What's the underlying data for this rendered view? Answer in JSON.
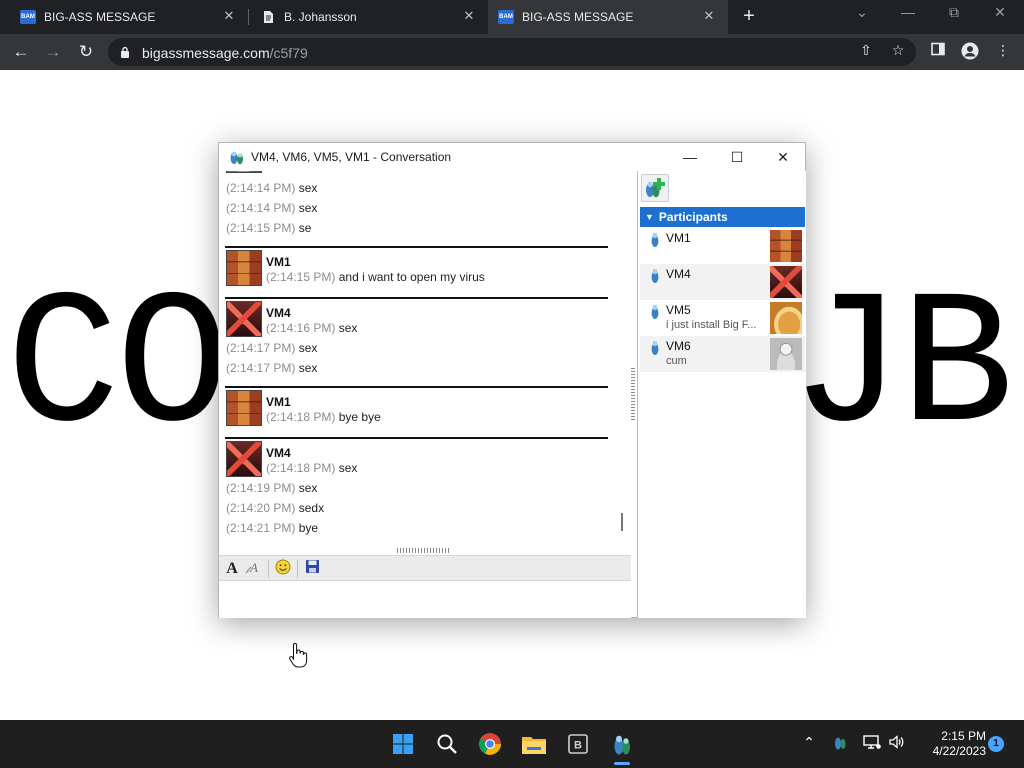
{
  "browser": {
    "tabs": [
      {
        "title": "BIG-ASS MESSAGE",
        "favicon": "bam-icon",
        "active": false
      },
      {
        "title": "B. Johansson",
        "favicon": "doc-icon",
        "active": false
      },
      {
        "title": "BIG-ASS MESSAGE",
        "favicon": "bam-icon",
        "active": true
      }
    ],
    "favicon_text": "BAM",
    "url_host": "bigassmessage.com",
    "url_path": "/c5f79",
    "icons": {
      "back": "←",
      "forward": "→",
      "reload": "↻",
      "share": "⇧",
      "star": "☆",
      "menu": "⋮",
      "new_tab": "+",
      "tab_close": "✕",
      "win_min": "—",
      "win_restore": "⧉",
      "win_close": "✕",
      "tab_search": "⌄"
    }
  },
  "page": {
    "big_left": "CO",
    "big_right": "JB"
  },
  "conversation": {
    "title": "VM4, VM6, VM5, VM1 - Conversation",
    "window_buttons": {
      "minimize": "—",
      "maximize": "☐",
      "close": "✕"
    },
    "lines": [
      {
        "ts": "(2:14:14 PM)",
        "text": "sex"
      },
      {
        "ts": "(2:14:14 PM)",
        "text": "sex"
      },
      {
        "ts": "(2:14:15 PM)",
        "text": "se"
      }
    ],
    "blocks": [
      {
        "user": "VM1",
        "avatar": "crates",
        "first": {
          "ts": "(2:14:15 PM)",
          "text": "and i want to open my virus"
        },
        "more": []
      },
      {
        "user": "VM4",
        "avatar": "bird",
        "first": {
          "ts": "(2:14:16 PM)",
          "text": "sex"
        },
        "more": [
          {
            "ts": "(2:14:17 PM)",
            "text": "sex"
          },
          {
            "ts": "(2:14:17 PM)",
            "text": "sex"
          }
        ]
      },
      {
        "user": "VM1",
        "avatar": "crates",
        "first": {
          "ts": "(2:14:18 PM)",
          "text": "bye bye"
        },
        "more": []
      },
      {
        "user": "VM4",
        "avatar": "bird",
        "first": {
          "ts": "(2:14:18 PM)",
          "text": "sex"
        },
        "more": [
          {
            "ts": "(2:14:19 PM)",
            "text": "sex"
          },
          {
            "ts": "(2:14:20 PM)",
            "text": "sedx"
          },
          {
            "ts": "(2:14:21 PM)",
            "text": "bye"
          }
        ]
      }
    ],
    "format_icons": {
      "font": "A",
      "emoticon": "☺"
    },
    "compose_value": ""
  },
  "participants": {
    "header": "Participants",
    "list": [
      {
        "name": "VM1",
        "status": "",
        "avatar": "crates"
      },
      {
        "name": "VM4",
        "status": "",
        "avatar": "bird"
      },
      {
        "name": "VM5",
        "status": "i just install Big F...",
        "avatar": "guitar"
      },
      {
        "name": "VM6",
        "status": "cum",
        "avatar": "robot"
      }
    ]
  },
  "taskbar": {
    "apps": [
      "windows-start-icon",
      "search-icon",
      "chrome-icon",
      "file-explorer-icon",
      "app-icon",
      "pidgin-icon"
    ],
    "tray": {
      "chevron": "⌃",
      "volume": "🔊"
    },
    "time": "2:15 PM",
    "date": "4/22/2023",
    "notifications": "1"
  },
  "colors": {
    "participants_header": "#1d6fd0",
    "timestamp": "#8d8d8d",
    "browser_dark": "#202124"
  }
}
